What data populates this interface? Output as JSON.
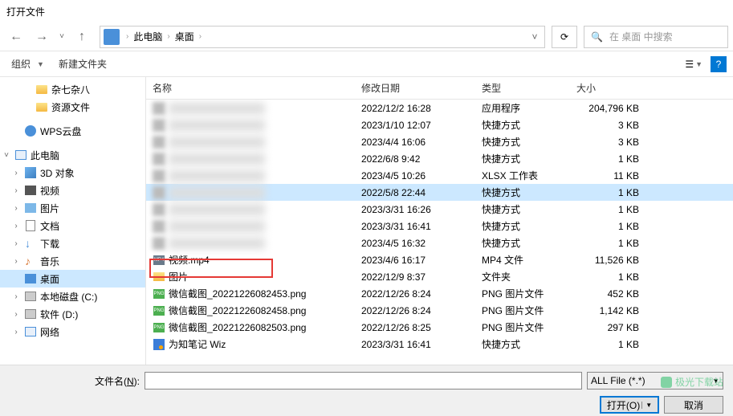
{
  "title": "打开文件",
  "nav": {
    "back": "←",
    "fwd": "→",
    "up": "↑"
  },
  "address": {
    "part1": "此电脑",
    "part2": "桌面"
  },
  "search": {
    "placeholder": "在 桌面 中搜索"
  },
  "toolbar": {
    "organize": "组织",
    "newfolder": "新建文件夹",
    "help": "?"
  },
  "columns": {
    "name": "名称",
    "date": "修改日期",
    "type": "类型",
    "size": "大小"
  },
  "sidebar": [
    {
      "label": "杂七杂八",
      "icon": "folder",
      "indent": 28
    },
    {
      "label": "资源文件",
      "icon": "folder",
      "indent": 28
    },
    {
      "label": "WPS云盘",
      "icon": "wps",
      "indent": 14,
      "caret": ""
    },
    {
      "label": "此电脑",
      "icon": "pc",
      "indent": 2,
      "caret": "˅"
    },
    {
      "label": "3D 对象",
      "icon": "obj3d",
      "indent": 14,
      "caret": "›"
    },
    {
      "label": "视频",
      "icon": "video",
      "indent": 14,
      "caret": "›"
    },
    {
      "label": "图片",
      "icon": "pic",
      "indent": 14,
      "caret": "›"
    },
    {
      "label": "文档",
      "icon": "doc",
      "indent": 14,
      "caret": "›"
    },
    {
      "label": "下载",
      "icon": "dl",
      "indent": 14,
      "caret": "›"
    },
    {
      "label": "音乐",
      "icon": "music",
      "indent": 14,
      "caret": "›"
    },
    {
      "label": "桌面",
      "icon": "desktop",
      "indent": 14,
      "caret": "",
      "active": true
    },
    {
      "label": "本地磁盘 (C:)",
      "icon": "disk",
      "indent": 14,
      "caret": "›"
    },
    {
      "label": "软件 (D:)",
      "icon": "disk",
      "indent": 14,
      "caret": "›"
    },
    {
      "label": "网络",
      "icon": "pc",
      "indent": 14,
      "caret": "›"
    }
  ],
  "files": [
    {
      "name": "",
      "blur": true,
      "date": "2022/12/2 16:28",
      "type": "应用程序",
      "size": "204,796 KB"
    },
    {
      "name": "",
      "blur": true,
      "date": "2023/1/10 12:07",
      "type": "快捷方式",
      "size": "3 KB"
    },
    {
      "name": "",
      "blur": true,
      "date": "2023/4/4 16:06",
      "type": "快捷方式",
      "size": "3 KB"
    },
    {
      "name": "",
      "blur": true,
      "date": "2022/6/8 9:42",
      "type": "快捷方式",
      "size": "1 KB"
    },
    {
      "name": "",
      "blur": true,
      "date": "2023/4/5 10:26",
      "type": "XLSX 工作表",
      "size": "11 KB"
    },
    {
      "name": "件",
      "blur": true,
      "date": "2022/5/8 22:44",
      "type": "快捷方式",
      "size": "1 KB",
      "selected": true
    },
    {
      "name": "",
      "blur": true,
      "date": "2023/3/31 16:26",
      "type": "快捷方式",
      "size": "1 KB"
    },
    {
      "name": "",
      "blur": true,
      "date": "2023/3/31 16:41",
      "type": "快捷方式",
      "size": "1 KB"
    },
    {
      "name": "",
      "blur": true,
      "date": "2023/4/5 16:32",
      "type": "快捷方式",
      "size": "1 KB"
    },
    {
      "name": "视频.mp4",
      "icon": "mp4",
      "date": "2023/4/6 16:17",
      "type": "MP4 文件",
      "size": "11,526 KB"
    },
    {
      "name": "图片",
      "icon": "folder",
      "date": "2022/12/9 8:37",
      "type": "文件夹",
      "size": "1 KB"
    },
    {
      "name": "微信截图_20221226082453.png",
      "icon": "png",
      "date": "2022/12/26 8:24",
      "type": "PNG 图片文件",
      "size": "452 KB"
    },
    {
      "name": "微信截图_20221226082458.png",
      "icon": "png",
      "date": "2022/12/26 8:24",
      "type": "PNG 图片文件",
      "size": "1,142 KB"
    },
    {
      "name": "微信截图_20221226082503.png",
      "icon": "png",
      "date": "2022/12/26 8:25",
      "type": "PNG 图片文件",
      "size": "297 KB"
    },
    {
      "name": "为知笔记 Wiz",
      "icon": "wiz",
      "date": "2023/3/31 16:41",
      "type": "快捷方式",
      "size": "1 KB"
    }
  ],
  "bottom": {
    "filename_label": "文件名(N):",
    "filter": "ALL File (*.*)",
    "open": "打开(O)",
    "cancel": "取消"
  },
  "watermark": "极光下载站"
}
